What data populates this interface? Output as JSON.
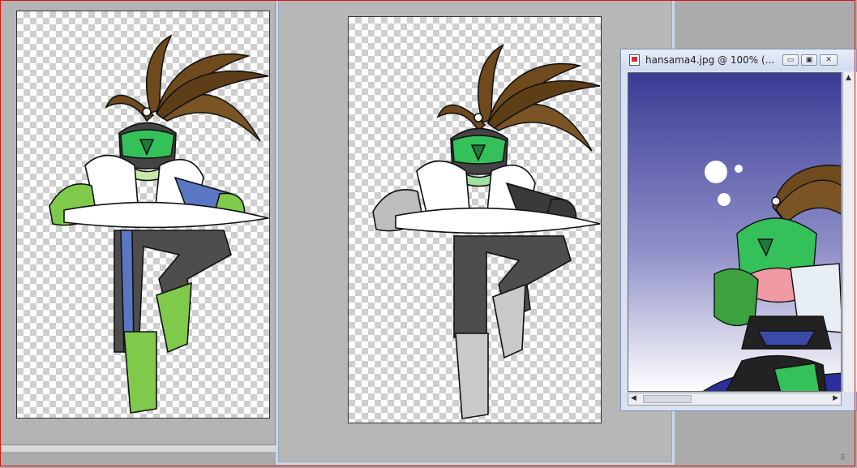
{
  "documents": [
    {
      "name": "colored-figure-document"
    },
    {
      "name": "partial-gray-figure-document"
    }
  ],
  "reference_window": {
    "title": "hansama4.jpg @ 100%  (...",
    "buttons": {
      "minimize": "▭",
      "maximize": "▣",
      "close": "✕"
    },
    "scroll_arrows": {
      "up": "▲",
      "left": "◀",
      "right": "▶"
    }
  },
  "colors": {
    "hair": "#6e4a1c",
    "helmet": "#34c15a",
    "glove": "#7fca4a",
    "pants": "#4d4d4d",
    "stripe": "#5a77c4",
    "sky_top": "#3a3c95",
    "sky_bottom": "#ffffff"
  },
  "icons": {
    "resize_grip": "resize-grip-icon"
  },
  "grip_glyph": "⠿"
}
